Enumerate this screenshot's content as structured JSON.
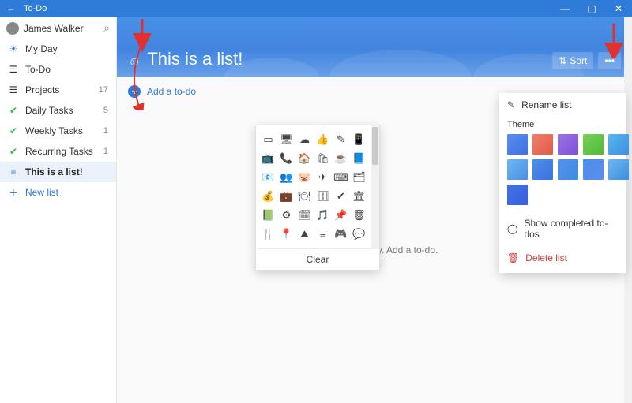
{
  "titlebar": {
    "app": "To-Do"
  },
  "sidebar": {
    "user": "James Walker",
    "items": [
      {
        "icon": "☀",
        "iconName": "sun-icon",
        "label": "My Day",
        "count": "",
        "iconClass": "ico-sun"
      },
      {
        "icon": "☰",
        "iconName": "list-icon",
        "label": "To-Do",
        "count": "",
        "iconClass": ""
      },
      {
        "icon": "☰",
        "iconName": "list-icon",
        "label": "Projects",
        "count": "17",
        "iconClass": ""
      },
      {
        "icon": "✔",
        "iconName": "check-icon",
        "label": "Daily Tasks",
        "count": "5",
        "iconClass": "ico-check"
      },
      {
        "icon": "✔",
        "iconName": "check-icon",
        "label": "Weekly Tasks",
        "count": "1",
        "iconClass": "ico-check"
      },
      {
        "icon": "✔",
        "iconName": "check-icon",
        "label": "Recurring Tasks",
        "count": "1",
        "iconClass": "ico-check"
      },
      {
        "icon": "≡",
        "iconName": "bullet-list-icon",
        "label": "This is a list!",
        "count": "",
        "iconClass": "ico-listblue",
        "active": true
      }
    ],
    "newList": "New list"
  },
  "hero": {
    "icon": "☺",
    "title": "This is a list!",
    "sort": "Sort",
    "more": "•••"
  },
  "addRow": "Add a to-do",
  "emptyState": "Your list is empty. Add a to-do.",
  "iconPicker": {
    "clear": "Clear",
    "icons": [
      "▭",
      "🖥",
      "☁",
      "👍",
      "✎",
      "📱",
      "📺",
      "📞",
      "🏠",
      "🛍",
      "☕",
      "📘",
      "📧",
      "👥",
      "🐷",
      "✈",
      "⌨",
      "🗂",
      "💰",
      "💼",
      "🍽",
      "🗄",
      "✔",
      "🏛",
      "📗",
      "⚙",
      "🗓",
      "🎵",
      "📌",
      "🗑",
      "🍴",
      "📍",
      "⛰",
      "≡",
      "🎮",
      "💬"
    ]
  },
  "panel": {
    "rename": "Rename list",
    "theme": "Theme",
    "showCompleted": "Show completed to-dos",
    "delete": "Delete list",
    "swatchCount": 11
  }
}
